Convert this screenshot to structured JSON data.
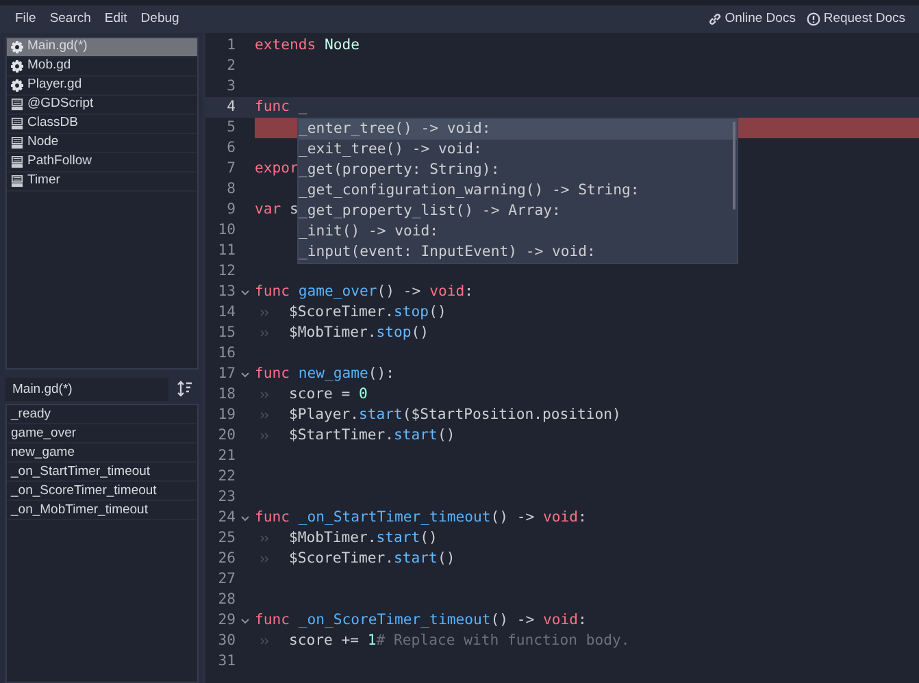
{
  "menu": [
    "File",
    "Search",
    "Edit",
    "Debug"
  ],
  "help_links": [
    {
      "kind": "link",
      "label": "Online Docs"
    },
    {
      "kind": "request",
      "label": "Request Docs"
    }
  ],
  "files": [
    {
      "kind": "script",
      "label": "Main.gd(*)",
      "selected": true
    },
    {
      "kind": "script",
      "label": "Mob.gd",
      "selected": false
    },
    {
      "kind": "script",
      "label": "Player.gd",
      "selected": false
    },
    {
      "kind": "doc",
      "label": "@GDScript",
      "selected": false
    },
    {
      "kind": "doc",
      "label": "ClassDB",
      "selected": false
    },
    {
      "kind": "doc",
      "label": "Node",
      "selected": false
    },
    {
      "kind": "doc",
      "label": "PathFollow",
      "selected": false
    },
    {
      "kind": "doc",
      "label": "Timer",
      "selected": false
    }
  ],
  "methods_filter": {
    "value": "Main.gd(*)"
  },
  "methods": [
    "_ready",
    "game_over",
    "new_game",
    "_on_StartTimer_timeout",
    "_on_ScoreTimer_timeout",
    "_on_MobTimer_timeout"
  ],
  "code_lines": [
    {
      "number": "1",
      "tokens": [
        {
          "kind": "keyword",
          "text": "extends "
        },
        {
          "kind": "type",
          "text": "Node"
        }
      ]
    },
    {
      "number": "2"
    },
    {
      "number": "3"
    },
    {
      "number": "4",
      "current": true,
      "tokens": [
        {
          "kind": "keyword",
          "text": "func "
        },
        {
          "kind": "plain",
          "text": "_"
        }
      ]
    },
    {
      "number": "5",
      "error": true
    },
    {
      "number": "6"
    },
    {
      "number": "7",
      "tokens": [
        {
          "kind": "keyword",
          "text": "expor"
        }
      ]
    },
    {
      "number": "8"
    },
    {
      "number": "9",
      "tokens": [
        {
          "kind": "keyword",
          "text": "var "
        },
        {
          "kind": "plain",
          "text": "s"
        }
      ]
    },
    {
      "number": "10"
    },
    {
      "number": "11"
    },
    {
      "number": "12"
    },
    {
      "number": "13",
      "foldable": true,
      "tokens": [
        {
          "kind": "keyword",
          "text": "func "
        },
        {
          "kind": "function",
          "text": "game_over"
        },
        {
          "kind": "plain",
          "text": "() -> "
        },
        {
          "kind": "keyword",
          "text": "void"
        },
        {
          "kind": "plain",
          "text": ":"
        }
      ]
    },
    {
      "number": "14",
      "tab": true,
      "tokens": [
        {
          "kind": "plain",
          "text": "$ScoreTimer."
        },
        {
          "kind": "call",
          "text": "stop"
        },
        {
          "kind": "plain",
          "text": "()"
        }
      ]
    },
    {
      "number": "15",
      "tab": true,
      "tokens": [
        {
          "kind": "plain",
          "text": "$MobTimer."
        },
        {
          "kind": "call",
          "text": "stop"
        },
        {
          "kind": "plain",
          "text": "()"
        }
      ]
    },
    {
      "number": "16"
    },
    {
      "number": "17",
      "foldable": true,
      "tokens": [
        {
          "kind": "keyword",
          "text": "func "
        },
        {
          "kind": "function",
          "text": "new_game"
        },
        {
          "kind": "plain",
          "text": "():"
        }
      ]
    },
    {
      "number": "18",
      "tab": true,
      "tokens": [
        {
          "kind": "plain",
          "text": "score = "
        },
        {
          "kind": "number",
          "text": "0"
        }
      ]
    },
    {
      "number": "19",
      "tab": true,
      "tokens": [
        {
          "kind": "plain",
          "text": "$Player."
        },
        {
          "kind": "call",
          "text": "start"
        },
        {
          "kind": "plain",
          "text": "($StartPosition.position)"
        }
      ]
    },
    {
      "number": "20",
      "tab": true,
      "tokens": [
        {
          "kind": "plain",
          "text": "$StartTimer."
        },
        {
          "kind": "call",
          "text": "start"
        },
        {
          "kind": "plain",
          "text": "()"
        }
      ]
    },
    {
      "number": "21"
    },
    {
      "number": "22"
    },
    {
      "number": "23"
    },
    {
      "number": "24",
      "foldable": true,
      "tokens": [
        {
          "kind": "keyword",
          "text": "func "
        },
        {
          "kind": "function",
          "text": "_on_StartTimer_timeout"
        },
        {
          "kind": "plain",
          "text": "() -> "
        },
        {
          "kind": "keyword",
          "text": "void"
        },
        {
          "kind": "plain",
          "text": ":"
        }
      ]
    },
    {
      "number": "25",
      "tab": true,
      "tokens": [
        {
          "kind": "plain",
          "text": "$MobTimer."
        },
        {
          "kind": "call",
          "text": "start"
        },
        {
          "kind": "plain",
          "text": "()"
        }
      ]
    },
    {
      "number": "26",
      "tab": true,
      "tokens": [
        {
          "kind": "plain",
          "text": "$ScoreTimer."
        },
        {
          "kind": "call",
          "text": "start"
        },
        {
          "kind": "plain",
          "text": "()"
        }
      ]
    },
    {
      "number": "27"
    },
    {
      "number": "28"
    },
    {
      "number": "29",
      "foldable": true,
      "tokens": [
        {
          "kind": "keyword",
          "text": "func "
        },
        {
          "kind": "function",
          "text": "_on_ScoreTimer_timeout"
        },
        {
          "kind": "plain",
          "text": "() -> "
        },
        {
          "kind": "keyword",
          "text": "void"
        },
        {
          "kind": "plain",
          "text": ":"
        }
      ]
    },
    {
      "number": "30",
      "tab": true,
      "tokens": [
        {
          "kind": "plain",
          "text": "score += "
        },
        {
          "kind": "number",
          "text": "1"
        },
        {
          "kind": "comment",
          "text": "# Replace with function body."
        }
      ]
    },
    {
      "number": "31"
    }
  ],
  "autocomplete": [
    {
      "label": "_enter_tree() -> void:",
      "selected": true
    },
    {
      "label": "_exit_tree() -> void:",
      "selected": false
    },
    {
      "label": "_get(property: String):",
      "selected": false
    },
    {
      "label": "_get_configuration_warning() -> String:",
      "selected": false
    },
    {
      "label": "_get_property_list() -> Array:",
      "selected": false
    },
    {
      "label": "_init() -> void:",
      "selected": false
    },
    {
      "label": "_input(event: InputEvent) -> void:",
      "selected": false
    }
  ]
}
